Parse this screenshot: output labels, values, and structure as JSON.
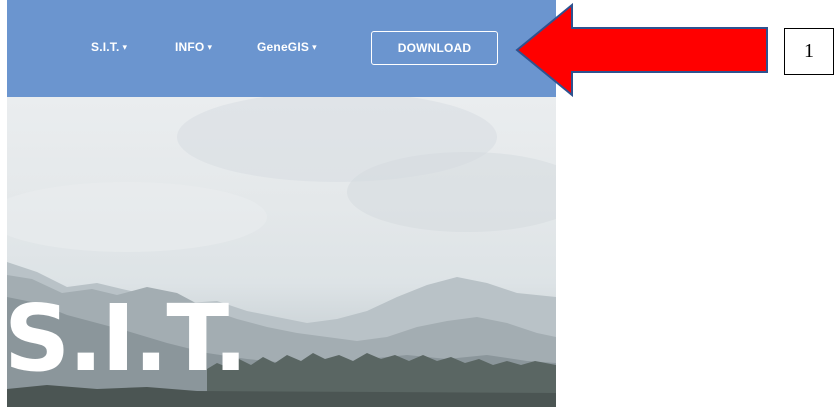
{
  "navbar": {
    "items": [
      {
        "label": "S.I.T.",
        "caret": "▾"
      },
      {
        "label": "INFO",
        "caret": "▾"
      },
      {
        "label": "GeneGIS",
        "caret": "▾"
      }
    ],
    "download_label": "DOWNLOAD",
    "background_color": "#6b95cf"
  },
  "hero": {
    "title": "S.I.T."
  },
  "annotation": {
    "arrow_color": "#ff0000",
    "arrow_outline_color": "#2f528f",
    "label": "1"
  }
}
